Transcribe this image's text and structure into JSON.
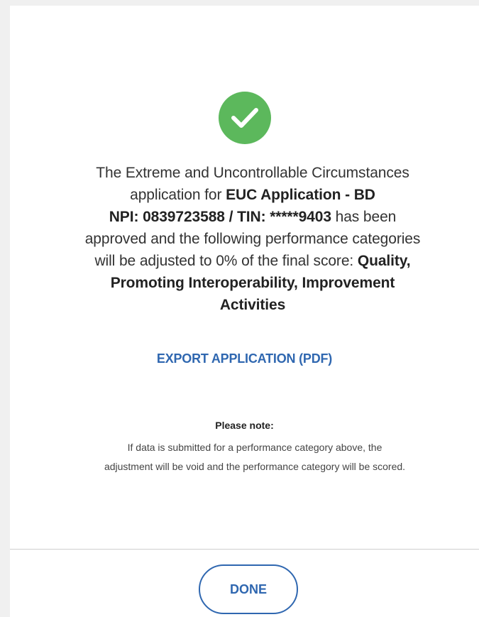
{
  "dialog": {
    "status_icon": "check-circle-icon",
    "message": {
      "line1": "The Extreme and Uncontrollable Circumstances",
      "line2_prefix": "application for ",
      "application_name": "EUC Application - BD",
      "identifiers": "NPI: 0839723588 / TIN: *****9403",
      "line3_suffix": " has been",
      "line4": "approved and the following performance categories",
      "line5_prefix": "will be adjusted to 0% of the final score: ",
      "categories_part1": "Quality,",
      "categories_part2": "Promoting Interoperability, Improvement",
      "categories_part3": "Activities"
    },
    "export_label": "EXPORT APPLICATION (PDF)",
    "note": {
      "title": "Please note:",
      "line1": "If data is submitted for a performance category above, the",
      "line2": "adjustment will be void and the performance category will be scored."
    },
    "done_label": "DONE"
  },
  "colors": {
    "success": "#5cb85c",
    "link": "#2f67b0",
    "background": "#f0f0f0"
  }
}
